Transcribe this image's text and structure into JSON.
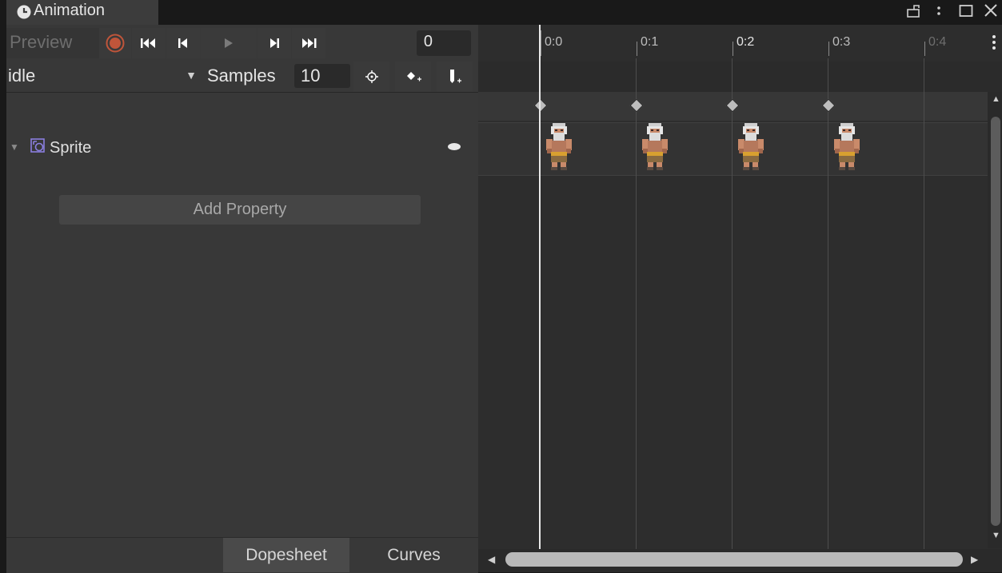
{
  "window": {
    "tab_title": "Animation",
    "tab_icon": "animation-clock-icon",
    "controls": [
      "lock-icon",
      "more-menu-icon",
      "maximize-icon",
      "close-icon"
    ]
  },
  "toolbar": {
    "preview_label": "Preview",
    "record_icon": "record-icon",
    "first_key_icon": "first-keyframe-icon",
    "prev_key_icon": "previous-keyframe-icon",
    "play_icon": "play-icon",
    "next_key_icon": "next-keyframe-icon",
    "last_key_icon": "last-keyframe-icon",
    "current_frame": "0",
    "record_color": "#c0553a"
  },
  "clip_bar": {
    "clip_name": "idle",
    "samples_label": "Samples",
    "samples_value": "10",
    "filter_icon": "filter-by-selection-icon",
    "add_keyframe_icon": "add-keyframe-icon",
    "add_event_icon": "add-event-icon"
  },
  "properties": {
    "items": [
      {
        "label": "Sprite",
        "icon": "sprite-renderer-icon",
        "expanded": true
      }
    ],
    "add_property_label": "Add Property"
  },
  "timeline": {
    "ruler_labels": [
      "0:0",
      "0:1",
      "0:2",
      "0:3",
      "0:4"
    ],
    "keyframes": [
      "0:0",
      "0:1",
      "0:2",
      "0:3"
    ],
    "playhead": "0:0"
  },
  "bottom_tabs": {
    "dopesheet_label": "Dopesheet",
    "curves_label": "Curves",
    "active": "Dopesheet"
  }
}
